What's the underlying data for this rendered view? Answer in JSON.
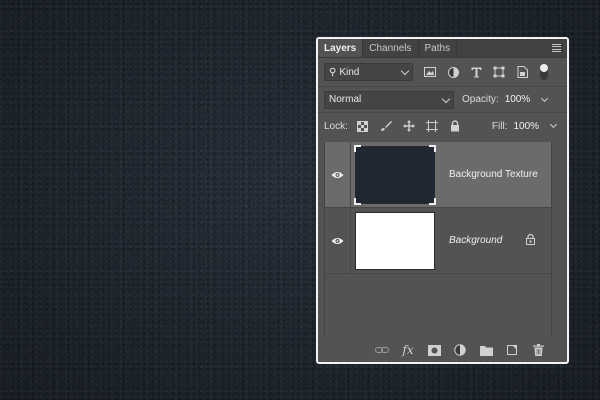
{
  "tabs": [
    {
      "label": "Layers",
      "active": true
    },
    {
      "label": "Channels",
      "active": false
    },
    {
      "label": "Paths",
      "active": false
    }
  ],
  "filter": {
    "kind_label": "Kind",
    "icons": [
      "image-filter-icon",
      "adjustment-filter-icon",
      "type-filter-icon",
      "shape-filter-icon",
      "smart-object-filter-icon"
    ]
  },
  "blend": {
    "mode": "Normal",
    "opacity_label": "Opacity:",
    "opacity_value": "100%"
  },
  "lock": {
    "label": "Lock:",
    "fill_label": "Fill:",
    "fill_value": "100%"
  },
  "layers": [
    {
      "name": "Background Texture",
      "selected": true,
      "visible": true,
      "locked": false,
      "thumb_color": "#1f2733"
    },
    {
      "name": "Background",
      "selected": false,
      "visible": true,
      "locked": true,
      "thumb_color": "#ffffff"
    }
  ],
  "bottom_icons": [
    "link-layers-icon",
    "fx-icon",
    "add-mask-icon",
    "adjustment-layer-icon",
    "new-group-icon",
    "new-layer-icon",
    "delete-layer-icon"
  ],
  "colors": {
    "panel": "#535353",
    "selected_row": "#6b6b6b",
    "canvas": "#1f2630"
  }
}
